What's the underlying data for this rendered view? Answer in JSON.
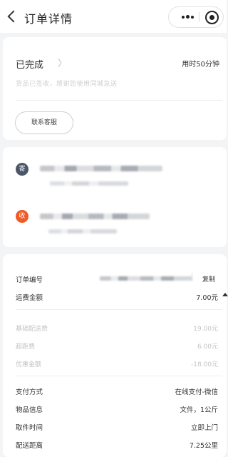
{
  "nav": {
    "title": "订单详情",
    "back_icon": "chevron-left-icon",
    "more_icon": "more-dots-icon",
    "target_icon": "target-icon"
  },
  "status": {
    "label": "已完成",
    "arrow": "〉",
    "elapsed": "用时50分钟",
    "hint": "货品已签收，感谢您使用同城急送",
    "contact_button": "联系客服"
  },
  "addresses": {
    "sender_badge": "寄",
    "receiver_badge": "收",
    "colors": {
      "sender": "#4b5668",
      "receiver": "#f05a24"
    }
  },
  "details": {
    "order_no_label": "订单编号",
    "copy_label": "复制",
    "fee_label": "运费金额",
    "fee_value": "7.00元",
    "base_fee_label": "基础配送费",
    "base_fee_value": "19.00元",
    "distance_fee_label": "超距费",
    "distance_fee_value": "6.00元",
    "discount_label": "优惠金额",
    "discount_value": "-18.00元",
    "pay_label": "支付方式",
    "pay_value": "在线支付-微信",
    "goods_label": "物品信息",
    "goods_value": "文件，1公斤",
    "pickup_label": "取件时间",
    "pickup_value": "立即上门",
    "distance_label": "配送距离",
    "distance_value": "7.25公里"
  }
}
